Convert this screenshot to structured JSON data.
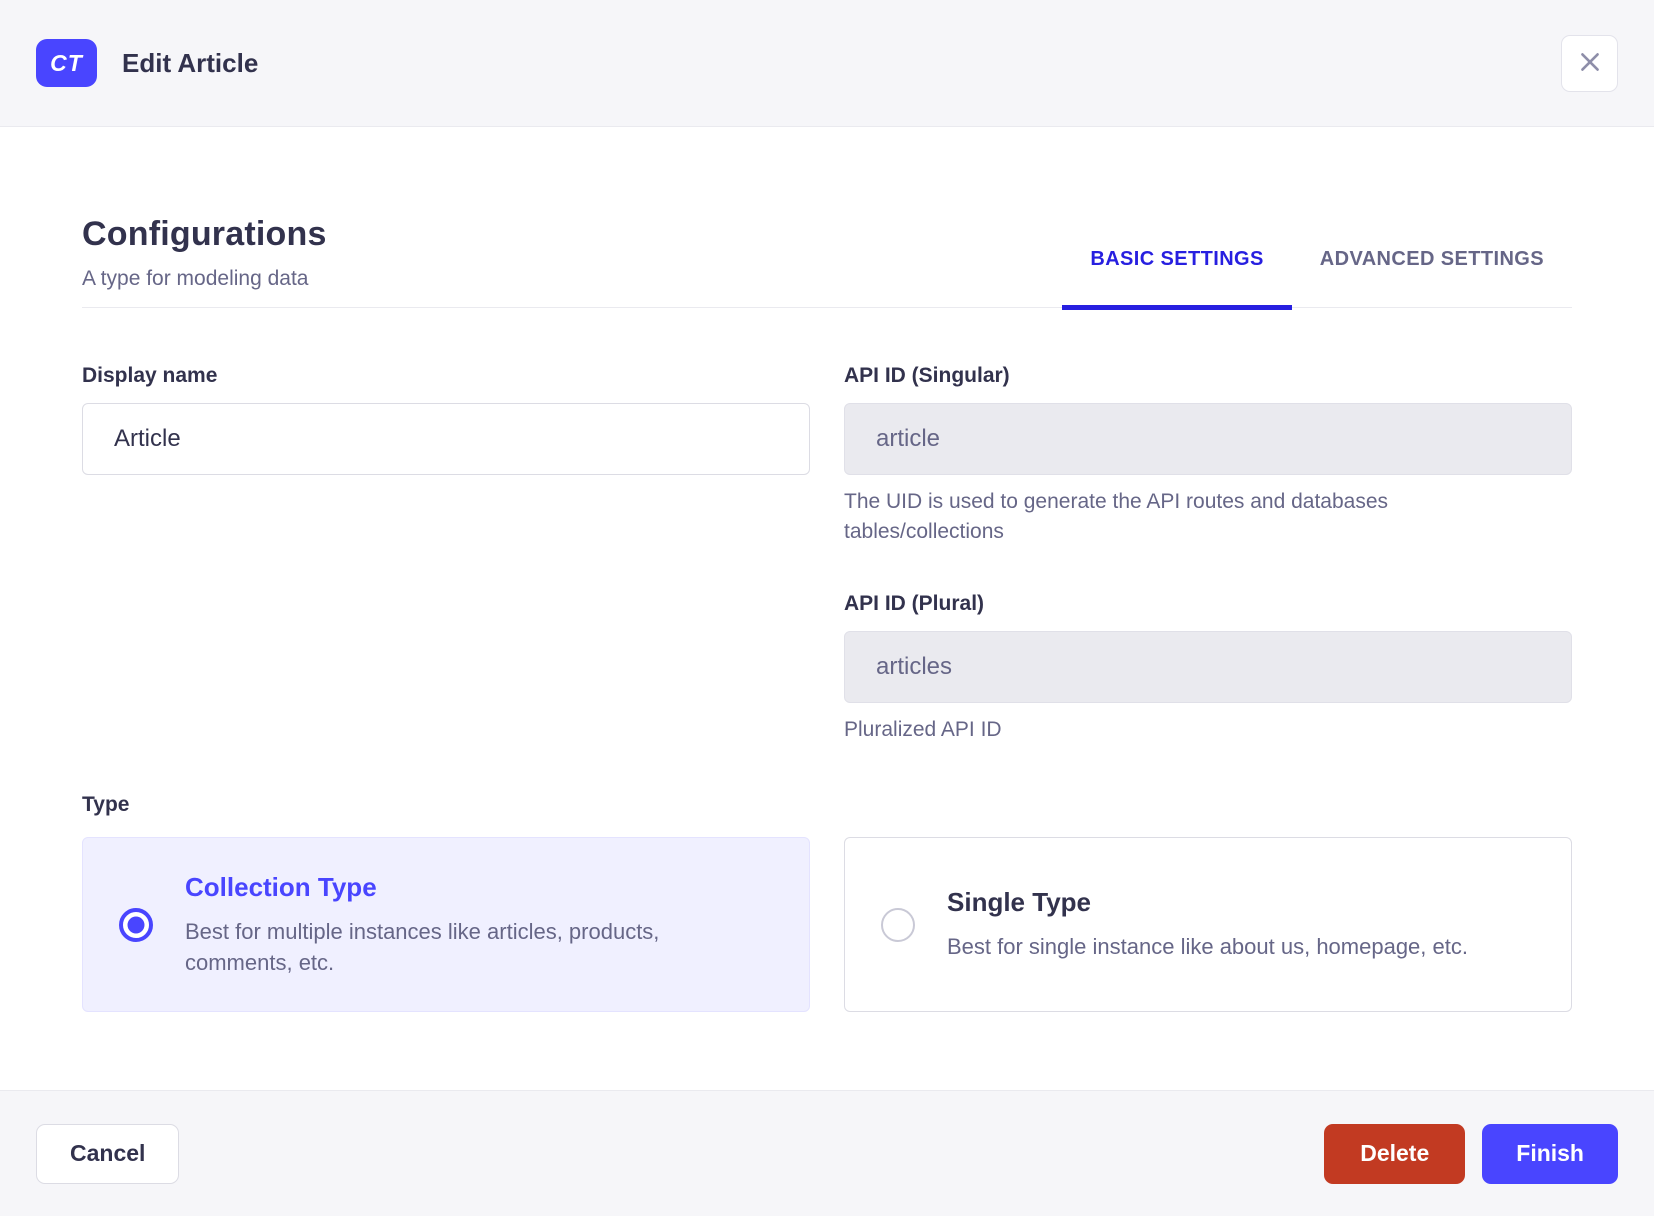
{
  "header": {
    "badge": "CT",
    "title": "Edit Article"
  },
  "section": {
    "title": "Configurations",
    "subtitle": "A type for modeling data",
    "tabs": [
      {
        "label": "BASIC SETTINGS",
        "active": true
      },
      {
        "label": "ADVANCED SETTINGS",
        "active": false
      }
    ]
  },
  "form": {
    "display_name": {
      "label": "Display name",
      "value": "Article"
    },
    "api_id_singular": {
      "label": "API ID (Singular)",
      "value": "article",
      "helper": "The UID is used to generate the API routes and databases tables/collections"
    },
    "api_id_plural": {
      "label": "API ID (Plural)",
      "value": "articles",
      "helper": "Pluralized API ID"
    },
    "type": {
      "label": "Type",
      "options": [
        {
          "title": "Collection Type",
          "description": "Best for multiple instances like articles, products, comments, etc.",
          "selected": true
        },
        {
          "title": "Single Type",
          "description": "Best for single instance like about us, homepage, etc.",
          "selected": false
        }
      ]
    }
  },
  "footer": {
    "cancel_label": "Cancel",
    "delete_label": "Delete",
    "finish_label": "Finish"
  },
  "icons": {
    "close": "close-icon"
  },
  "colors": {
    "primary": "#4945FF",
    "tab_active": "#271FE0",
    "danger": "#C23A22",
    "surface": "#F6F6F9",
    "border": "#EAEAEF",
    "text_dark": "#32324D",
    "text_muted": "#666687",
    "selected_card_bg": "#F0F0FF",
    "disabled_input_bg": "#EAEAEF"
  }
}
